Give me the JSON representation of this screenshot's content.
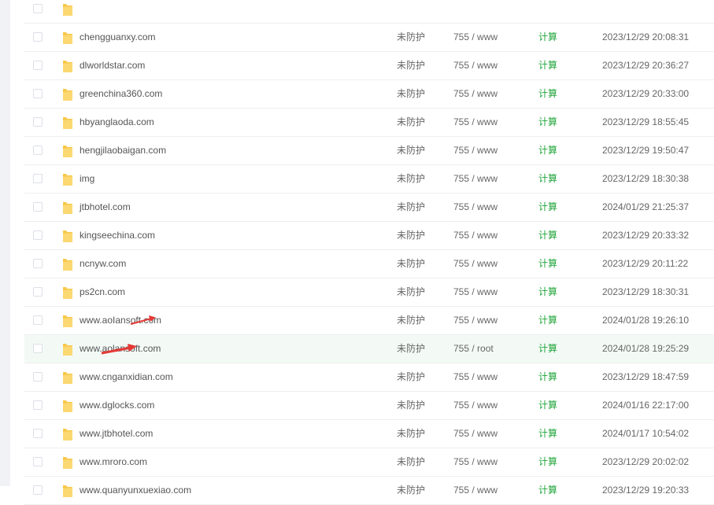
{
  "file_table": {
    "rows": [
      {
        "name": "",
        "protect": "",
        "perm": "",
        "calc": "",
        "time": ""
      },
      {
        "name": "chengguanxy.com",
        "protect": "未防护",
        "perm": "755 / www",
        "calc": "计算",
        "time": "2023/12/29 20:08:31"
      },
      {
        "name": "dlworldstar.com",
        "protect": "未防护",
        "perm": "755 / www",
        "calc": "计算",
        "time": "2023/12/29 20:36:27"
      },
      {
        "name": "greenchina360.com",
        "protect": "未防护",
        "perm": "755 / www",
        "calc": "计算",
        "time": "2023/12/29 20:33:00"
      },
      {
        "name": "hbyanglaoda.com",
        "protect": "未防护",
        "perm": "755 / www",
        "calc": "计算",
        "time": "2023/12/29 18:55:45"
      },
      {
        "name": "hengjilaobaigan.com",
        "protect": "未防护",
        "perm": "755 / www",
        "calc": "计算",
        "time": "2023/12/29 19:50:47"
      },
      {
        "name": "img",
        "protect": "未防护",
        "perm": "755 / www",
        "calc": "计算",
        "time": "2023/12/29 18:30:38"
      },
      {
        "name": "jtbhotel.com",
        "protect": "未防护",
        "perm": "755 / www",
        "calc": "计算",
        "time": "2024/01/29 21:25:37"
      },
      {
        "name": "kingseechina.com",
        "protect": "未防护",
        "perm": "755 / www",
        "calc": "计算",
        "time": "2023/12/29 20:33:32"
      },
      {
        "name": "ncnyw.com",
        "protect": "未防护",
        "perm": "755 / www",
        "calc": "计算",
        "time": "2023/12/29 20:11:22"
      },
      {
        "name": "ps2cn.com",
        "protect": "未防护",
        "perm": "755 / www",
        "calc": "计算",
        "time": "2023/12/29 18:30:31"
      },
      {
        "name": "www.aoIansoft.com",
        "protect": "未防护",
        "perm": "755 / www",
        "calc": "计算",
        "time": "2024/01/28 19:26:10"
      },
      {
        "name": "www.aolansoft.com",
        "protect": "未防护",
        "perm": "755 / root",
        "calc": "计算",
        "time": "2024/01/28 19:25:29"
      },
      {
        "name": "www.cnganxidian.com",
        "protect": "未防护",
        "perm": "755 / www",
        "calc": "计算",
        "time": "2023/12/29 18:47:59"
      },
      {
        "name": "www.dglocks.com",
        "protect": "未防护",
        "perm": "755 / www",
        "calc": "计算",
        "time": "2024/01/16 22:17:00"
      },
      {
        "name": "www.jtbhotel.com",
        "protect": "未防护",
        "perm": "755 / www",
        "calc": "计算",
        "time": "2024/01/17 10:54:02"
      },
      {
        "name": "www.mroro.com",
        "protect": "未防护",
        "perm": "755 / www",
        "calc": "计算",
        "time": "2023/12/29 20:02:02"
      },
      {
        "name": "www.quanyunxuexiao.com",
        "protect": "未防护",
        "perm": "755 / www",
        "calc": "计算",
        "time": "2023/12/29 19:20:33"
      }
    ]
  },
  "colors": {
    "accent_green": "#20a53a",
    "selected_row_bg": "#f3faf6",
    "annotation_arrow": "#e53935",
    "folder_yellow": "#f8c84a"
  },
  "icons": {
    "folder": "folder-icon",
    "annotation": "red-arrow-annotation"
  }
}
